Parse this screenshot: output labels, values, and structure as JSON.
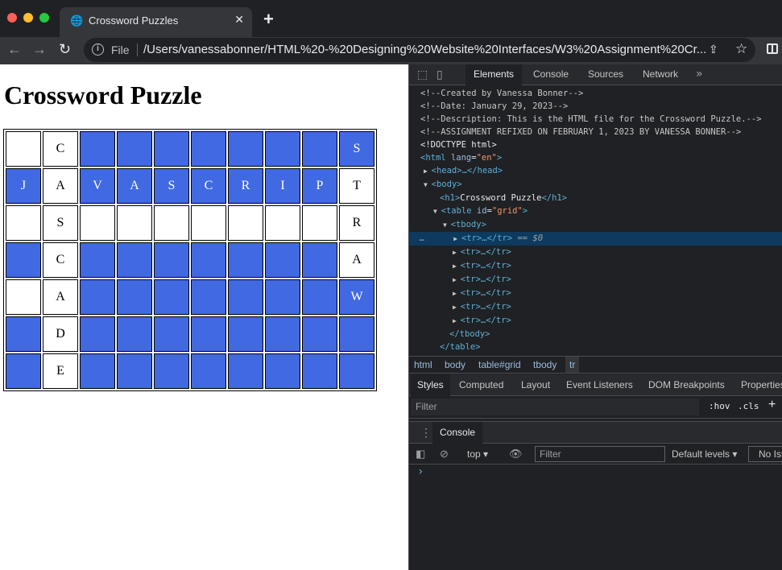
{
  "browser": {
    "tab_title": "Crossword Puzzles",
    "url_scheme": "File",
    "url": "/Users/vanessabonner/HTML%20-%20Designing%20Website%20Interfaces/W3%20Assignment%20Cr..."
  },
  "page": {
    "heading": "Crossword Puzzle",
    "grid": [
      [
        {
          "t": "",
          "c": "w"
        },
        {
          "t": "C",
          "c": "w"
        },
        {
          "t": "",
          "c": "b"
        },
        {
          "t": "",
          "c": "b"
        },
        {
          "t": "",
          "c": "b"
        },
        {
          "t": "",
          "c": "b"
        },
        {
          "t": "",
          "c": "b"
        },
        {
          "t": "",
          "c": "b"
        },
        {
          "t": "",
          "c": "b"
        },
        {
          "t": "S",
          "c": "b"
        }
      ],
      [
        {
          "t": "J",
          "c": "b"
        },
        {
          "t": "A",
          "c": "w"
        },
        {
          "t": "V",
          "c": "b"
        },
        {
          "t": "A",
          "c": "b"
        },
        {
          "t": "S",
          "c": "b"
        },
        {
          "t": "C",
          "c": "b"
        },
        {
          "t": "R",
          "c": "b"
        },
        {
          "t": "I",
          "c": "b"
        },
        {
          "t": "P",
          "c": "b"
        },
        {
          "t": "T",
          "c": "w"
        }
      ],
      [
        {
          "t": "",
          "c": "w"
        },
        {
          "t": "S",
          "c": "w"
        },
        {
          "t": "",
          "c": "w"
        },
        {
          "t": "",
          "c": "w"
        },
        {
          "t": "",
          "c": "w"
        },
        {
          "t": "",
          "c": "w"
        },
        {
          "t": "",
          "c": "w"
        },
        {
          "t": "",
          "c": "w"
        },
        {
          "t": "",
          "c": "w"
        },
        {
          "t": "R",
          "c": "w"
        }
      ],
      [
        {
          "t": "",
          "c": "b"
        },
        {
          "t": "C",
          "c": "w"
        },
        {
          "t": "",
          "c": "b"
        },
        {
          "t": "",
          "c": "b"
        },
        {
          "t": "",
          "c": "b"
        },
        {
          "t": "",
          "c": "b"
        },
        {
          "t": "",
          "c": "b"
        },
        {
          "t": "",
          "c": "b"
        },
        {
          "t": "",
          "c": "b"
        },
        {
          "t": "A",
          "c": "w"
        }
      ],
      [
        {
          "t": "",
          "c": "w"
        },
        {
          "t": "A",
          "c": "w"
        },
        {
          "t": "",
          "c": "b"
        },
        {
          "t": "",
          "c": "b"
        },
        {
          "t": "",
          "c": "b"
        },
        {
          "t": "",
          "c": "b"
        },
        {
          "t": "",
          "c": "b"
        },
        {
          "t": "",
          "c": "b"
        },
        {
          "t": "",
          "c": "b"
        },
        {
          "t": "W",
          "c": "b"
        }
      ],
      [
        {
          "t": "",
          "c": "b"
        },
        {
          "t": "D",
          "c": "w"
        },
        {
          "t": "",
          "c": "b"
        },
        {
          "t": "",
          "c": "b"
        },
        {
          "t": "",
          "c": "b"
        },
        {
          "t": "",
          "c": "b"
        },
        {
          "t": "",
          "c": "b"
        },
        {
          "t": "",
          "c": "b"
        },
        {
          "t": "",
          "c": "b"
        },
        {
          "t": "",
          "c": "b"
        }
      ],
      [
        {
          "t": "",
          "c": "b"
        },
        {
          "t": "E",
          "c": "w"
        },
        {
          "t": "",
          "c": "b"
        },
        {
          "t": "",
          "c": "b"
        },
        {
          "t": "",
          "c": "b"
        },
        {
          "t": "",
          "c": "b"
        },
        {
          "t": "",
          "c": "b"
        },
        {
          "t": "",
          "c": "b"
        },
        {
          "t": "",
          "c": "b"
        },
        {
          "t": "",
          "c": "b"
        }
      ]
    ],
    "colors": {
      "blue_cell": "#4169e1",
      "white_cell": "#ffffff"
    }
  },
  "devtools": {
    "tabs": [
      "Elements",
      "Console",
      "Sources",
      "Network"
    ],
    "more_tabs": "»",
    "comments": [
      "<!--Created by Vanessa Bonner-->",
      "<!--Date: January 29, 2023-->",
      "<!--Description: This is the HTML file for the Crossword Puzzle.-->",
      "<!--ASSIGNMENT REFIXED ON FEBRUARY 1, 2023 BY VANESSA BONNER-->"
    ],
    "doctype": "<!DOCTYPE html>",
    "html_open": "<html ",
    "html_attr_name": "lang",
    "html_attr_value": "\"en\"",
    "head_line": "<head>…</head>",
    "body_open": "<body>",
    "h1_open": "<h1>",
    "h1_text": "Crossword Puzzle",
    "h1_close": "</h1>",
    "table_open": "<table ",
    "table_attr_name": "id",
    "table_attr_value": "\"grid\"",
    "tbody_open": "<tbody>",
    "tr_line": "<tr>…</tr>",
    "selected_marker": "== $0",
    "tbody_close": "</tbody>",
    "table_close": "</table>",
    "breadcrumbs": [
      "html",
      "body",
      "table#grid",
      "tbody",
      "tr"
    ],
    "subtabs": [
      "Styles",
      "Computed",
      "Layout",
      "Event Listeners",
      "DOM Breakpoints",
      "Properties"
    ],
    "filter_placeholder": "Filter",
    "hov": ":hov",
    "cls": ".cls",
    "drawer_tab": "Console",
    "context": "top",
    "console_filter": "Filter",
    "levels": "Default levels ▾",
    "no_issues": "No Issues",
    "prompt": "›"
  }
}
